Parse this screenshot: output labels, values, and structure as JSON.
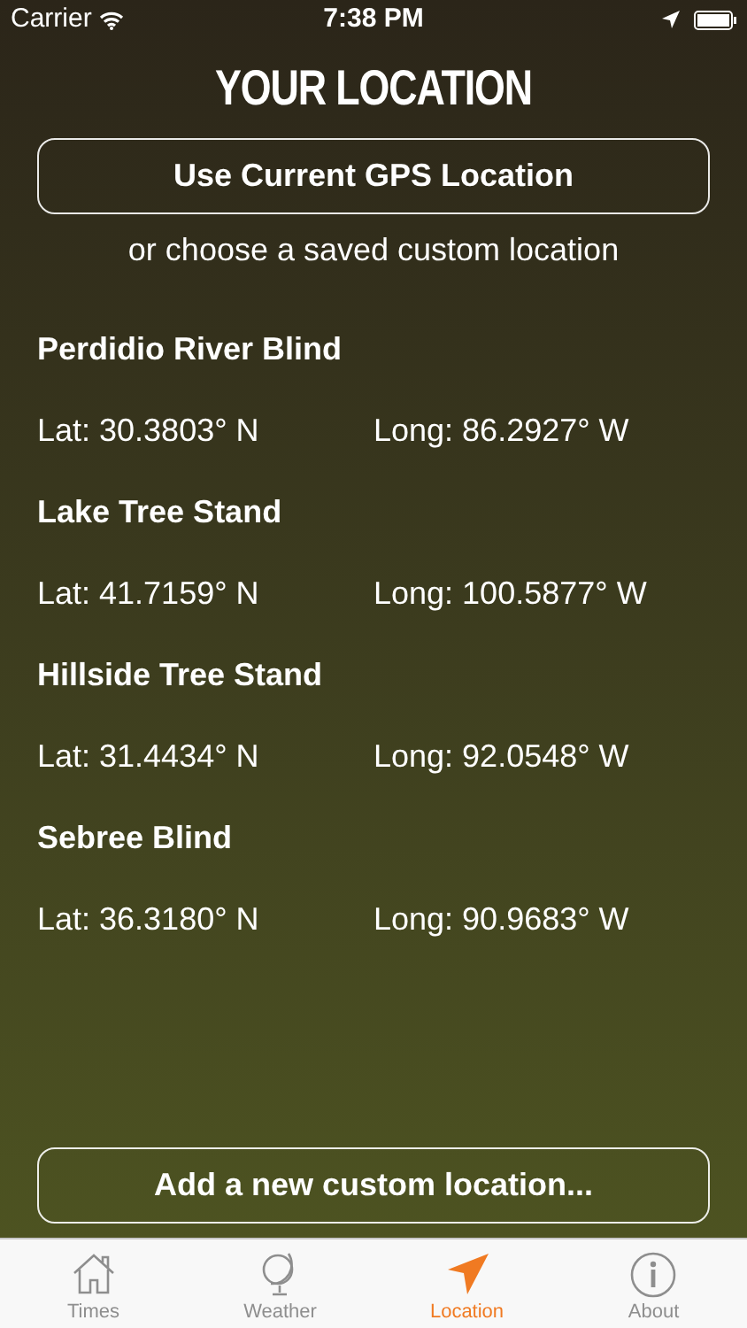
{
  "status_bar": {
    "carrier": "Carrier",
    "time": "7:38 PM"
  },
  "title": "YOUR LOCATION",
  "gps_button": "Use Current GPS Location",
  "subtitle": "or choose a saved custom location",
  "locations": [
    {
      "name": "Perdidio River Blind",
      "lat": "Lat: 30.3803° N",
      "long": "Long: 86.2927° W"
    },
    {
      "name": "Lake Tree Stand",
      "lat": "Lat: 41.7159° N",
      "long": "Long: 100.5877° W"
    },
    {
      "name": "Hillside Tree Stand",
      "lat": "Lat: 31.4434° N",
      "long": "Long: 92.0548° W"
    },
    {
      "name": "Sebree Blind",
      "lat": "Lat: 36.3180° N",
      "long": "Long: 90.9683° W"
    }
  ],
  "add_button": "Add a new custom location...",
  "tabs": [
    {
      "kind": "home",
      "label": "Times",
      "selected": false
    },
    {
      "kind": "globe",
      "label": "Weather",
      "selected": false
    },
    {
      "kind": "arrow",
      "label": "Location",
      "selected": true
    },
    {
      "kind": "info",
      "label": "About",
      "selected": false
    }
  ]
}
